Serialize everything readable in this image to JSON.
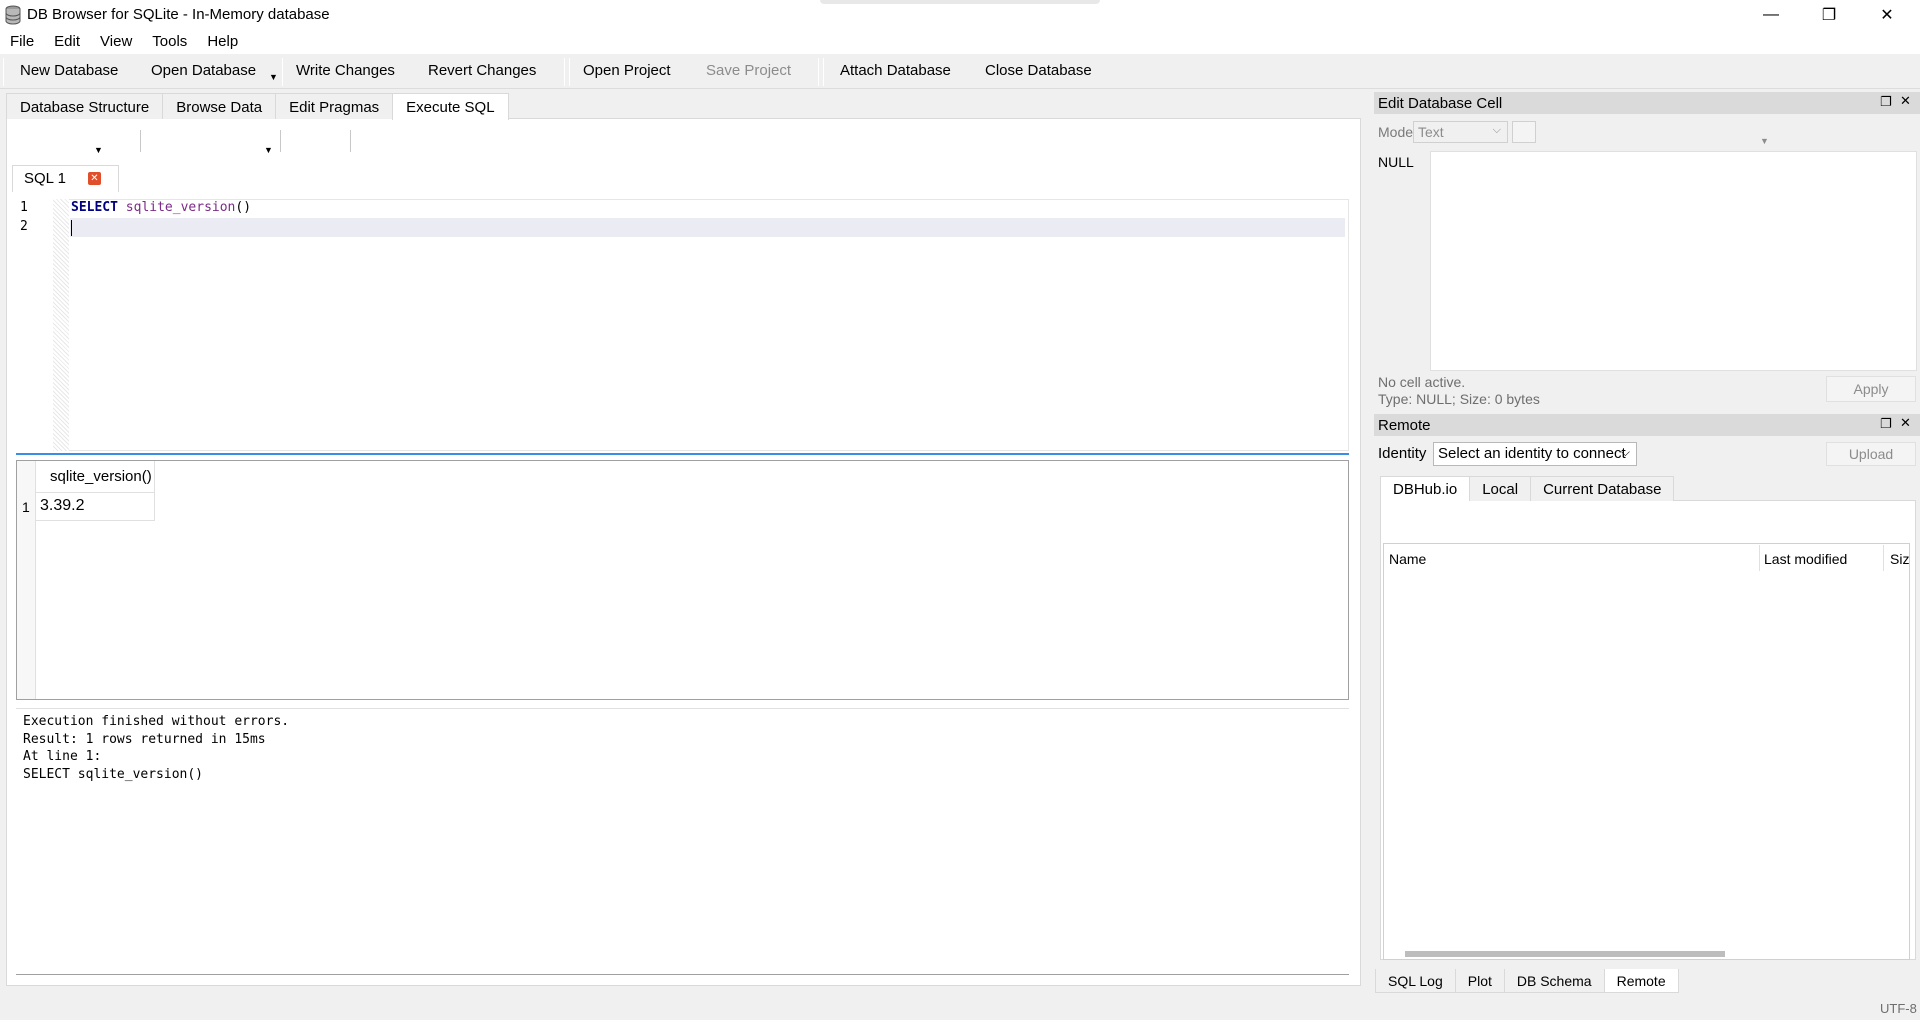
{
  "window": {
    "title": "DB Browser for SQLite - In-Memory database",
    "minimize": "—",
    "restore": "❐",
    "close": "✕"
  },
  "menu": [
    "File",
    "Edit",
    "View",
    "Tools",
    "Help"
  ],
  "toolbar": {
    "new_database": "New Database",
    "open_database": "Open Database",
    "write_changes": "Write Changes",
    "revert_changes": "Revert Changes",
    "open_project": "Open Project",
    "save_project": "Save Project",
    "attach_database": "Attach Database",
    "close_database": "Close Database"
  },
  "main_tabs": [
    "Database Structure",
    "Browse Data",
    "Edit Pragmas",
    "Execute SQL"
  ],
  "active_main_tab": "Execute SQL",
  "sql_tab": {
    "label": "SQL 1",
    "close": "✕"
  },
  "editor": {
    "line_numbers": [
      "1",
      "2"
    ],
    "keyword": "SELECT",
    "function": "sqlite_version",
    "parens": "()"
  },
  "results": {
    "column": "sqlite_version()",
    "row_number": "1",
    "value": "3.39.2"
  },
  "messages": [
    "Execution finished without errors.",
    "Result: 1 rows returned in 15ms",
    "At line 1:",
    "SELECT sqlite_version()"
  ],
  "edit_cell": {
    "title": "Edit Database Cell",
    "mode_label": "Mode:",
    "mode_value": "Text",
    "null_label": "NULL",
    "no_cell": "No cell active.",
    "type_info": "Type: NULL; Size: 0 bytes",
    "apply": "Apply"
  },
  "remote": {
    "title": "Remote",
    "identity_label": "Identity",
    "identity_value": "Select an identity to connect",
    "upload": "Upload",
    "tabs": [
      "DBHub.io",
      "Local",
      "Current Database"
    ],
    "columns": [
      "Name",
      "Last modified",
      "Size"
    ]
  },
  "bottom_tabs": [
    "SQL Log",
    "Plot",
    "DB Schema",
    "Remote"
  ],
  "status": {
    "encoding": "UTF-8"
  }
}
